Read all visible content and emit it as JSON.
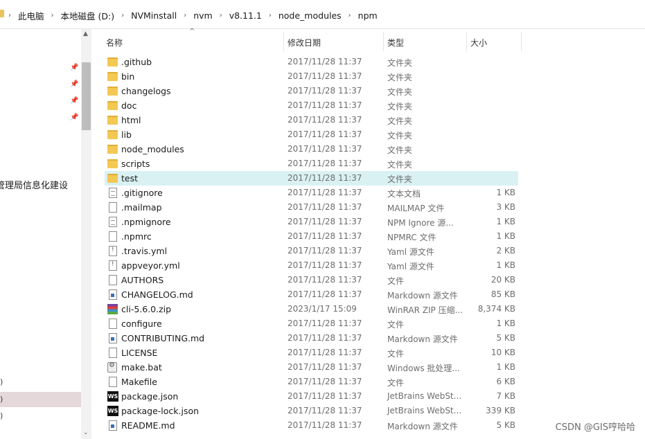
{
  "breadcrumb": [
    "此电脑",
    "本地磁盘 (D:)",
    "NVMinstall",
    "nvm",
    "v8.11.1",
    "node_modules",
    "npm"
  ],
  "breadcrumb_separator": "›",
  "nav": {
    "partial_item": "管理局信息化建设",
    "small_items": [
      ")",
      ")",
      ")"
    ]
  },
  "columns": {
    "name": "名称",
    "date": "修改日期",
    "type": "类型",
    "size": "大小"
  },
  "files": [
    {
      "name": ".github",
      "date": "2017/11/28 11:37",
      "type": "文件夹",
      "size": "",
      "icon": "folder"
    },
    {
      "name": "bin",
      "date": "2017/11/28 11:37",
      "type": "文件夹",
      "size": "",
      "icon": "folder"
    },
    {
      "name": "changelogs",
      "date": "2017/11/28 11:37",
      "type": "文件夹",
      "size": "",
      "icon": "folder"
    },
    {
      "name": "doc",
      "date": "2017/11/28 11:37",
      "type": "文件夹",
      "size": "",
      "icon": "folder"
    },
    {
      "name": "html",
      "date": "2017/11/28 11:37",
      "type": "文件夹",
      "size": "",
      "icon": "folder"
    },
    {
      "name": "lib",
      "date": "2017/11/28 11:37",
      "type": "文件夹",
      "size": "",
      "icon": "folder"
    },
    {
      "name": "node_modules",
      "date": "2017/11/28 11:37",
      "type": "文件夹",
      "size": "",
      "icon": "folder"
    },
    {
      "name": "scripts",
      "date": "2017/11/28 11:37",
      "type": "文件夹",
      "size": "",
      "icon": "folder"
    },
    {
      "name": "test",
      "date": "2017/11/28 11:37",
      "type": "文件夹",
      "size": "",
      "icon": "folder",
      "selected": true
    },
    {
      "name": ".gitignore",
      "date": "2017/11/28 11:37",
      "type": "文本文档",
      "size": "1 KB",
      "icon": "text"
    },
    {
      "name": ".mailmap",
      "date": "2017/11/28 11:37",
      "type": "MAILMAP 文件",
      "size": "3 KB",
      "icon": "file"
    },
    {
      "name": ".npmignore",
      "date": "2017/11/28 11:37",
      "type": "NPM Ignore 源...",
      "size": "1 KB",
      "icon": "text"
    },
    {
      "name": ".npmrc",
      "date": "2017/11/28 11:37",
      "type": "NPMRC 文件",
      "size": "1 KB",
      "icon": "file"
    },
    {
      "name": ".travis.yml",
      "date": "2017/11/28 11:37",
      "type": "Yaml 源文件",
      "size": "2 KB",
      "icon": "script"
    },
    {
      "name": "appveyor.yml",
      "date": "2017/11/28 11:37",
      "type": "Yaml 源文件",
      "size": "1 KB",
      "icon": "script"
    },
    {
      "name": "AUTHORS",
      "date": "2017/11/28 11:37",
      "type": "文件",
      "size": "20 KB",
      "icon": "file"
    },
    {
      "name": "CHANGELOG.md",
      "date": "2017/11/28 11:37",
      "type": "Markdown 源文件",
      "size": "85 KB",
      "icon": "md"
    },
    {
      "name": "cli-5.6.0.zip",
      "date": "2023/1/17 15:09",
      "type": "WinRAR ZIP 压缩...",
      "size": "8,374 KB",
      "icon": "zip"
    },
    {
      "name": "configure",
      "date": "2017/11/28 11:37",
      "type": "文件",
      "size": "1 KB",
      "icon": "file"
    },
    {
      "name": "CONTRIBUTING.md",
      "date": "2017/11/28 11:37",
      "type": "Markdown 源文件",
      "size": "5 KB",
      "icon": "md"
    },
    {
      "name": "LICENSE",
      "date": "2017/11/28 11:37",
      "type": "文件",
      "size": "10 KB",
      "icon": "file"
    },
    {
      "name": "make.bat",
      "date": "2017/11/28 11:37",
      "type": "Windows 批处理...",
      "size": "1 KB",
      "icon": "bat"
    },
    {
      "name": "Makefile",
      "date": "2017/11/28 11:37",
      "type": "文件",
      "size": "6 KB",
      "icon": "file"
    },
    {
      "name": "package.json",
      "date": "2017/11/28 11:37",
      "type": "JetBrains WebSt...",
      "size": "7 KB",
      "icon": "ws"
    },
    {
      "name": "package-lock.json",
      "date": "2017/11/28 11:37",
      "type": "JetBrains WebSt...",
      "size": "339 KB",
      "icon": "ws"
    },
    {
      "name": "README.md",
      "date": "2017/11/28 11:37",
      "type": "Markdown 源文件",
      "size": "5 KB",
      "icon": "md"
    }
  ],
  "ws_label": "WS",
  "watermark": "CSDN @GIS哼哈哈"
}
